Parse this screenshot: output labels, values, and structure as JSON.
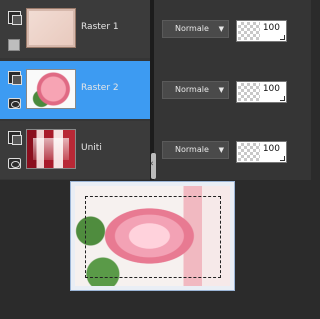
{
  "layers": [
    {
      "name": "Raster 1",
      "blend_mode": "Normale",
      "opacity": "100",
      "selected": false
    },
    {
      "name": "Raster 2",
      "blend_mode": "Normale",
      "opacity": "100",
      "selected": true
    },
    {
      "name": "Uniti",
      "blend_mode": "Normale",
      "opacity": "100",
      "selected": false
    }
  ],
  "colors": {
    "panel_bg": "#353535",
    "selected_bg": "#3d9bf2",
    "select_bg": "#4a4a4a"
  },
  "icons": {
    "mask": "mask-icon",
    "visibility": "eye-icon",
    "dropdown": "chevron-down-icon"
  }
}
